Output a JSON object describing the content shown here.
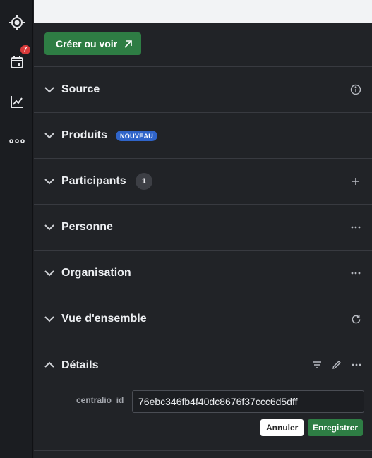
{
  "rail": {
    "items": [
      {
        "icon": "target-icon"
      },
      {
        "icon": "calendar-icon",
        "badge": "7"
      },
      {
        "icon": "chart-icon"
      },
      {
        "icon": "more-horizontal-icon"
      }
    ]
  },
  "toolbar": {
    "create_label": "Créer ou voir"
  },
  "sections": [
    {
      "title": "Source",
      "action_icon": "info-icon"
    },
    {
      "title": "Produits",
      "pill": "NOUVEAU"
    },
    {
      "title": "Participants",
      "count": "1",
      "action_icon": "plus-icon"
    },
    {
      "title": "Personne",
      "action_icon": "more-horizontal-icon"
    },
    {
      "title": "Organisation",
      "action_icon": "more-horizontal-icon"
    },
    {
      "title": "Vue d'ensemble",
      "action_icon": "refresh-icon"
    }
  ],
  "details": {
    "title": "Détails",
    "field_label": "centralio_id",
    "field_value": "76ebc346fb4f40dc8676f37ccc6d5dff",
    "cancel_label": "Annuler",
    "save_label": "Enregistrer"
  },
  "colors": {
    "accent_green": "#2e7d44",
    "badge_red": "#d93a3a",
    "pill_blue": "#2f64c9"
  }
}
